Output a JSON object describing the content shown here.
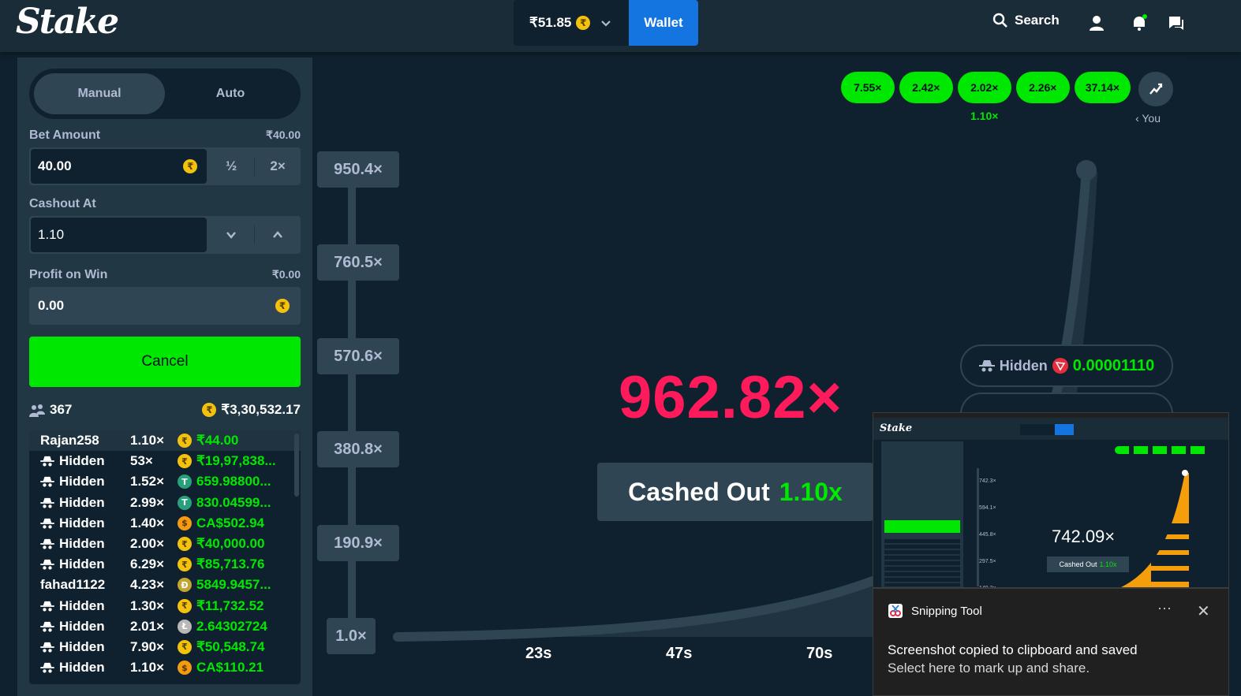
{
  "header": {
    "logo": "Stake",
    "balance": "₹51.85",
    "currency_icon": "rupee-coin-icon",
    "wallet_label": "Wallet",
    "search_label": "Search"
  },
  "sidebar": {
    "tabs": [
      "Manual",
      "Auto"
    ],
    "active_tab": "Manual",
    "bet_amount_label": "Bet Amount",
    "bet_amount_value_display": "₹40.00",
    "bet_amount_input": "40.00",
    "half_label": "½",
    "double_label": "2×",
    "cashout_label": "Cashout At",
    "cashout_input": "1.10",
    "profit_label": "Profit on Win",
    "profit_value_display": "₹0.00",
    "profit_input": "0.00",
    "cancel_label": "Cancel",
    "player_count": "367",
    "total_bet": "₹3,30,532.17"
  },
  "players": [
    {
      "name": "Rajan258",
      "hidden": false,
      "mult": "1.10×",
      "cur": "inr",
      "win": "₹44.00"
    },
    {
      "name": "Hidden",
      "hidden": true,
      "mult": "53×",
      "cur": "inr",
      "win": "₹19,97,838..."
    },
    {
      "name": "Hidden",
      "hidden": true,
      "mult": "1.52×",
      "cur": "usdt",
      "win": "659.98800..."
    },
    {
      "name": "Hidden",
      "hidden": true,
      "mult": "2.99×",
      "cur": "usdt",
      "win": "830.04599..."
    },
    {
      "name": "Hidden",
      "hidden": true,
      "mult": "1.40×",
      "cur": "cad",
      "win": "CA$502.94"
    },
    {
      "name": "Hidden",
      "hidden": true,
      "mult": "2.00×",
      "cur": "inr",
      "win": "₹40,000.00"
    },
    {
      "name": "Hidden",
      "hidden": true,
      "mult": "6.29×",
      "cur": "inr",
      "win": "₹85,713.76"
    },
    {
      "name": "fahad1122",
      "hidden": false,
      "mult": "4.23×",
      "cur": "doge",
      "win": "5849.9457..."
    },
    {
      "name": "Hidden",
      "hidden": true,
      "mult": "1.30×",
      "cur": "inr",
      "win": "₹11,732.52"
    },
    {
      "name": "Hidden",
      "hidden": true,
      "mult": "2.01×",
      "cur": "ltc",
      "win": "2.64302724"
    },
    {
      "name": "Hidden",
      "hidden": true,
      "mult": "7.90×",
      "cur": "inr",
      "win": "₹50,548.74"
    },
    {
      "name": "Hidden",
      "hidden": true,
      "mult": "1.10×",
      "cur": "cad",
      "win": "CA$110.21"
    }
  ],
  "game": {
    "history": [
      "7.55×",
      "2.42×",
      "2.02×",
      "2.26×",
      "37.14×"
    ],
    "history_sub": "1.10×",
    "you_label": "You",
    "y_ticks": [
      "950.4×",
      "760.5×",
      "570.6×",
      "380.8×",
      "190.9×",
      "1.0×"
    ],
    "x_ticks": [
      "23s",
      "47s",
      "70s"
    ],
    "multiplier": "962.82×",
    "cashed_label": "Cashed Out",
    "cashed_value": "1.10x",
    "live_player_name": "Hidden",
    "live_player_amount": "0.00001110"
  },
  "snip_preview": {
    "multiplier": "742.09×",
    "cashed_label": "Cashed Out",
    "cashed_value": "1.10x",
    "y_ticks": [
      "742.3×",
      "594.1×",
      "445.8×",
      "297.5×",
      "149.3×"
    ]
  },
  "toast": {
    "app": "Snipping Tool",
    "more": "···",
    "close": "✕",
    "message": "Screenshot copied to clipboard and saved",
    "sub": "Select here to mark up and share."
  },
  "colors": {
    "bg": "#0f212e",
    "panel": "#213743",
    "control": "#2f4553",
    "green": "#00e701",
    "blue": "#1475e1",
    "multiplier_red": "#ff1a5c"
  }
}
